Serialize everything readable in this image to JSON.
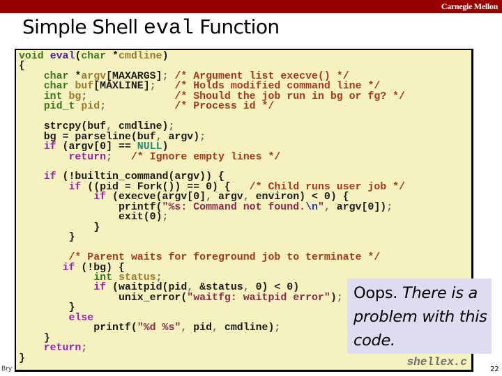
{
  "header": {
    "brand": "Carnegie Mellon",
    "brand_color": "#990000"
  },
  "slide": {
    "title_part1": "Simple Shell ",
    "title_mono": "eval",
    "title_part2": " Function",
    "footer_visible_text": "Bry",
    "page_number": "22"
  },
  "code": {
    "filename": "shellex.c",
    "background_color": "#f5f2c0",
    "lines": [
      "void eval(char *cmdline)",
      "{",
      "    char *argv[MAXARGS]; /* Argument list execve() */",
      "    char buf[MAXLINE];   /* Holds modified command line */",
      "    int bg;              /* Should the job run in bg or fg? */",
      "    pid_t pid;           /* Process id */",
      "",
      "    strcpy(buf, cmdline);",
      "    bg = parseline(buf, argv);",
      "    if (argv[0] == NULL)",
      "        return;   /* Ignore empty lines */",
      "",
      "    if (!builtin_command(argv)) {",
      "        if ((pid = Fork()) == 0) {   /* Child runs user job */",
      "            if (execve(argv[0], argv, environ) < 0) {",
      "                printf(\"%s: Command not found.\\n\", argv[0]);",
      "                exit(0);",
      "            }",
      "        }",
      "",
      "        /* Parent waits for foreground job to terminate */",
      "       if (!bg) {",
      "            int status;",
      "            if (waitpid(pid, &status, 0) < 0)",
      "                unix_error(\"waitfg: waitpid error\");",
      "        }",
      "        else",
      "            printf(\"%d %s\", pid, cmdline);",
      "    }",
      "    return;",
      "}"
    ]
  },
  "callout": {
    "lead": "Oops. ",
    "italic_text": "There is a problem with this code.",
    "background_color": "#dddcf0"
  }
}
